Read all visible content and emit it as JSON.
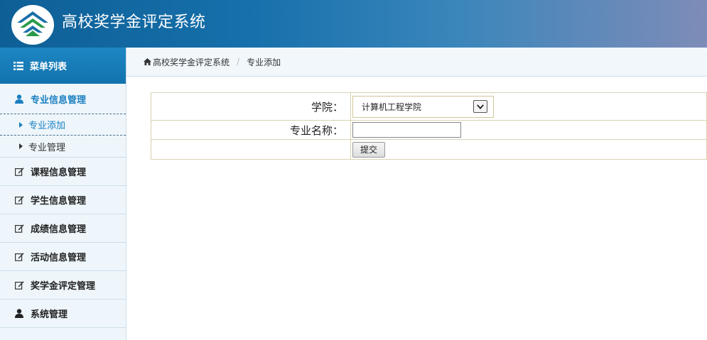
{
  "app": {
    "title": "高校奖学金评定系统"
  },
  "sidebar": {
    "header": "菜单列表",
    "groups": [
      {
        "label": "专业信息管理",
        "subitems": [
          {
            "label": "专业添加"
          },
          {
            "label": "专业管理"
          }
        ]
      },
      {
        "label": "课程信息管理"
      },
      {
        "label": "学生信息管理"
      },
      {
        "label": "成绩信息管理"
      },
      {
        "label": "活动信息管理"
      },
      {
        "label": "奖学金评定管理"
      },
      {
        "label": "系统管理"
      }
    ]
  },
  "breadcrumb": {
    "home": "高校奖学金评定系统",
    "current": "专业添加"
  },
  "form": {
    "college_label": "学院：",
    "college_value": "计算机工程学院",
    "major_label": "专业名称：",
    "major_value": "",
    "submit_label": "提交"
  },
  "colors": {
    "header": "#1670ab",
    "accent": "#1a7fc1",
    "sidebar_bg": "#eef6fb"
  }
}
